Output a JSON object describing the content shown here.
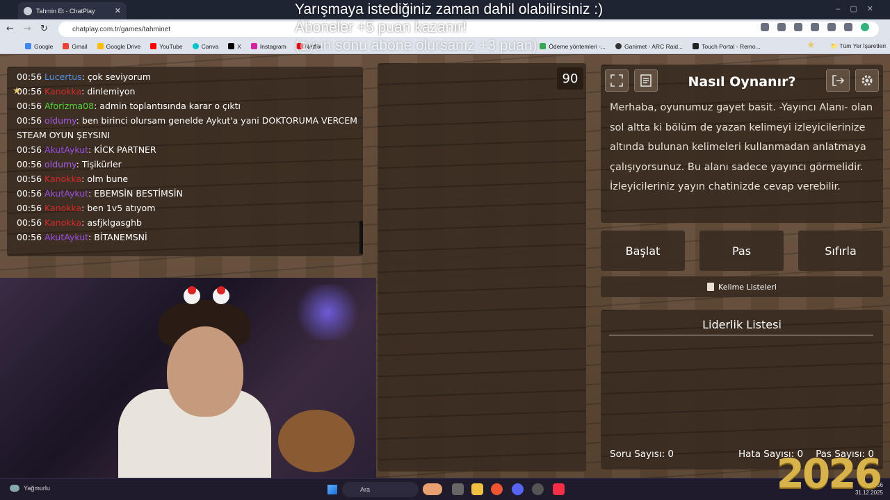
{
  "browser": {
    "tab_title": "Tahmin Et - ChatPlay",
    "url": "chatplay.com.tr/games/tahminet",
    "bookmarks": [
      "Google",
      "Gmail",
      "Google Drive",
      "YouTube",
      "Canva",
      "X",
      "Instagram",
      "Netflix",
      "Ödeme yöntemleri -...",
      "Ganimet - ARC Raid...",
      "Touch Portal - Remo..."
    ],
    "bookmarks_folder": "Tüm Yer İşaretleri"
  },
  "overlay": {
    "line1": "Yarışmaya istediğiniz zaman dahil olabilirsiniz :)",
    "line2": "Aboneler +5 puan kazanır!",
    "line3": "(oyun sonu abone olursanız +3 puan)"
  },
  "chat": {
    "messages": [
      {
        "time": "00:56",
        "user": "Lucertus",
        "color": "#4f8fe0",
        "text": ": çok seviyorum"
      },
      {
        "time": "00:56",
        "user": "Kanokka",
        "color": "#d42a2a",
        "text": ": dinlemiyon"
      },
      {
        "time": "00:56",
        "user": "Aforizma08",
        "color": "#56d43a",
        "text": ": admin toplantısında karar o çıktı"
      },
      {
        "time": "00:56",
        "user": "oldumy",
        "color": "#a45ae8",
        "text": ": ben birinci olursam genelde Aykut'a yani DOKTORUMA VERCEM STEAM OYUN ŞEYSINI"
      },
      {
        "time": "00:56",
        "user": "AkutAykut",
        "color": "#9a4ee6",
        "text": ": KİCK PARTNER"
      },
      {
        "time": "00:56",
        "user": "oldumy",
        "color": "#a45ae8",
        "text": ": Tişikürler"
      },
      {
        "time": "00:56",
        "user": "Kanokka",
        "color": "#d42a2a",
        "text": ": olm bune"
      },
      {
        "time": "00:56",
        "user": "AkutAykut",
        "color": "#9a4ee6",
        "text": ": EBEMSİN BESTİMSİN"
      },
      {
        "time": "00:56",
        "user": "Kanokka",
        "color": "#d42a2a",
        "text": ": ben 1v5 atıyom"
      },
      {
        "time": "00:56",
        "user": "Kanokka",
        "color": "#d42a2a",
        "text": ": asfjklgasghb"
      },
      {
        "time": "00:56",
        "user": "AkutAykut",
        "color": "#9a4ee6",
        "text": ": BİTANEMSNİ"
      }
    ]
  },
  "game": {
    "timer": "90",
    "howto_title": "Nasıl Oynanır?",
    "howto_text": "Merhaba, oyunumuz gayet basit. -Yayıncı Alanı- olan sol altta ki bölüm de yazan kelimeyi izleyicilerinize altında bulunan kelimeleri kullanmadan anlatmaya çalışıyorsunuz. Bu alanı sadece yayıncı görmelidir. İzleyicileriniz yayın chatinizde cevap verebilir.",
    "buttons": {
      "start": "Başlat",
      "pass": "Pas",
      "reset": "Sıfırla"
    },
    "word_lists": "Kelime Listeleri",
    "leaderboard_title": "Liderlik Listesi",
    "stats": {
      "questions": "Soru Sayısı: 0",
      "errors": "Hata Sayısı: 0",
      "passes": "Pas Sayısı: 0"
    }
  },
  "taskbar": {
    "weather": "Yağmurlu",
    "search": "Ara",
    "time": "00:56",
    "date": "31.12.2025",
    "year_decoration": "2026"
  }
}
